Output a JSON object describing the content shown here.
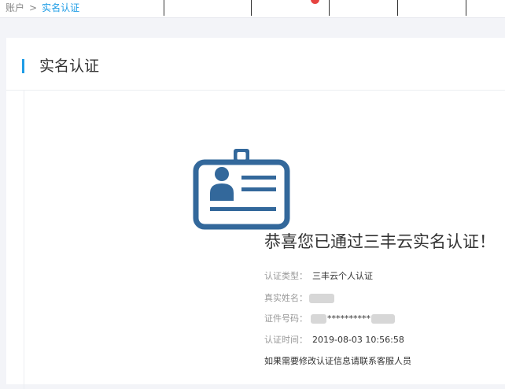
{
  "breadcrumb": {
    "root": "账户",
    "separator": ">",
    "current": "实名认证"
  },
  "page_title": "实名认证",
  "success_message": "恭喜您已通过三丰云实名认证！",
  "details": {
    "type_label": "认证类型：",
    "type_value": "三丰云个人认证",
    "name_label": "真实姓名：",
    "id_label": "证件号码：",
    "id_masked": "**********",
    "time_label": "认证时间：",
    "time_value": "2019-08-03 10:56:58"
  },
  "note": "如果需要修改认证信息请联系客服人员",
  "icons": {
    "id_card": "id-card-icon"
  },
  "colors": {
    "accent": "#1e9ce6",
    "icon": "#33689b",
    "badge": "#e64340"
  }
}
